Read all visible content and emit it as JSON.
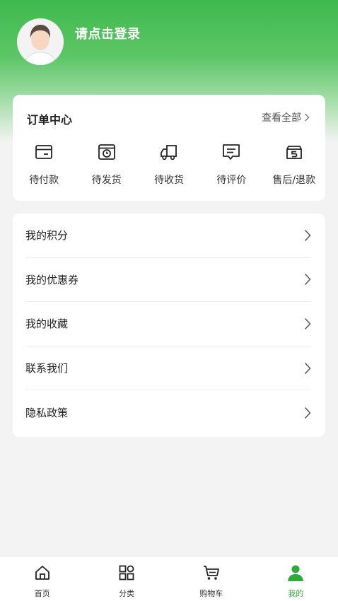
{
  "profile": {
    "login_prompt": "请点击登录"
  },
  "orders": {
    "title": "订单中心",
    "view_all": "查看全部",
    "items": [
      {
        "label": "待付款",
        "icon": "wallet-icon"
      },
      {
        "label": "待发货",
        "icon": "box-icon"
      },
      {
        "label": "待收货",
        "icon": "truck-icon"
      },
      {
        "label": "待评价",
        "icon": "comment-icon"
      },
      {
        "label": "售后/退款",
        "icon": "refund-icon"
      }
    ]
  },
  "menu": {
    "items": [
      {
        "label": "我的积分"
      },
      {
        "label": "我的优惠券"
      },
      {
        "label": "我的收藏"
      },
      {
        "label": "联系我们"
      },
      {
        "label": "隐私政策"
      }
    ]
  },
  "tabbar": {
    "items": [
      {
        "label": "首页",
        "icon": "home-icon"
      },
      {
        "label": "分类",
        "icon": "category-icon"
      },
      {
        "label": "购物车",
        "icon": "cart-icon"
      },
      {
        "label": "我的",
        "icon": "user-icon"
      }
    ],
    "active_color": "#2fab3c"
  },
  "colors": {
    "brand": "#3fb94c"
  }
}
